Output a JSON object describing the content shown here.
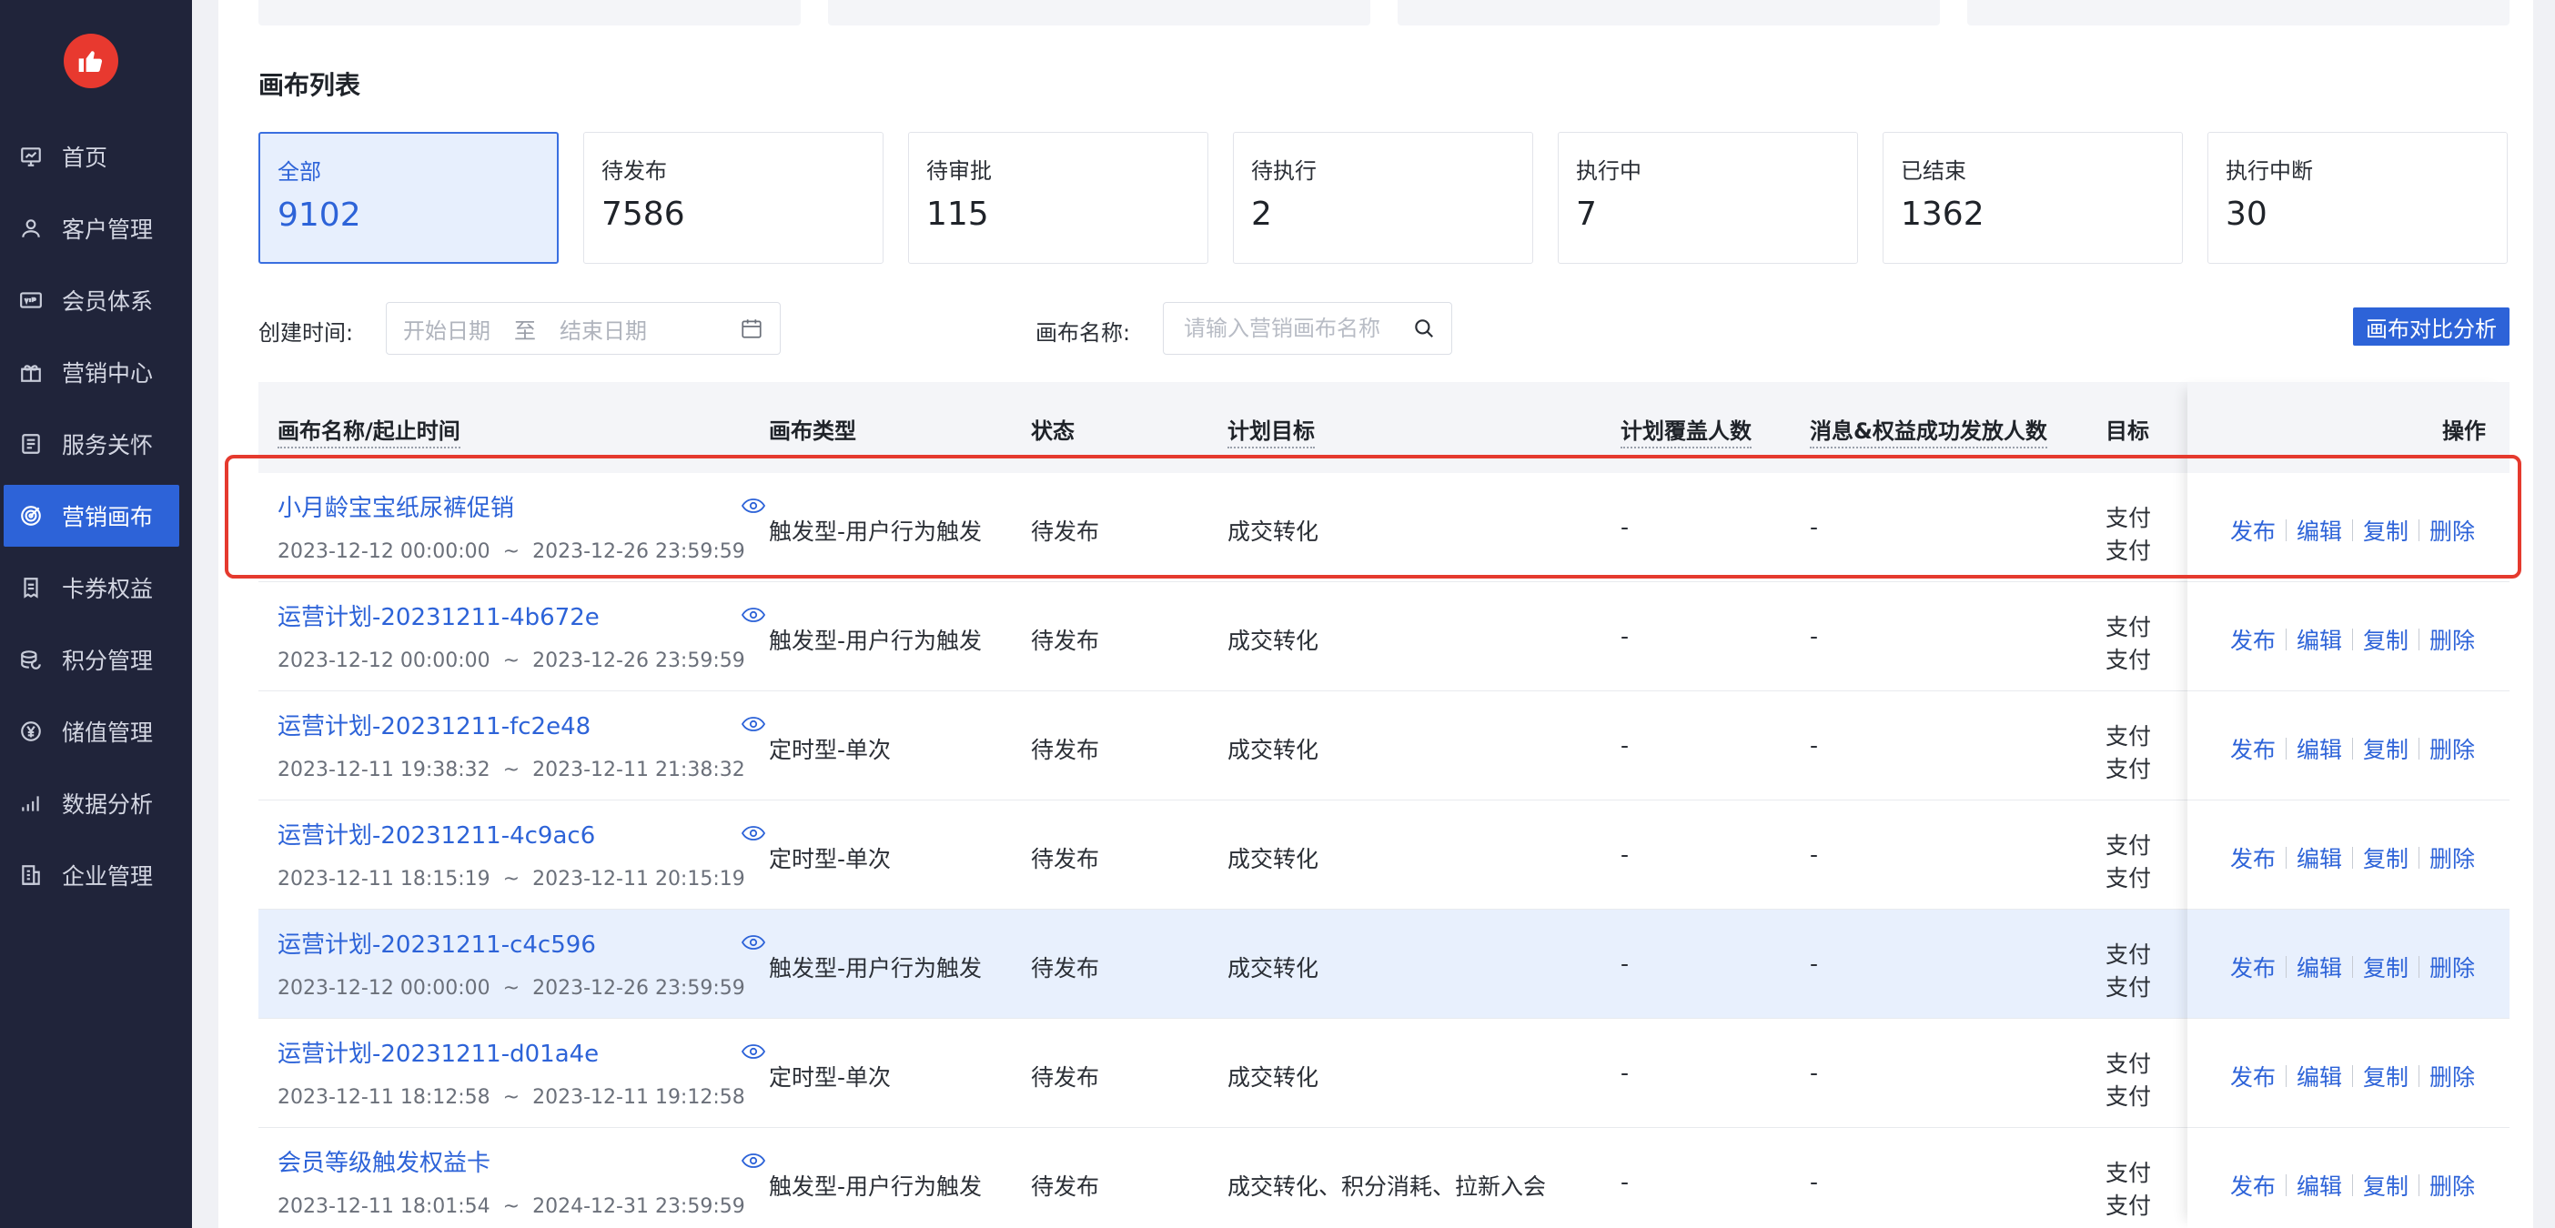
{
  "sidebar": {
    "logo_icon": "thumbs-up-icon",
    "items": [
      {
        "label": "首页",
        "icon": "home-board-icon"
      },
      {
        "label": "客户管理",
        "icon": "user-icon"
      },
      {
        "label": "会员体系",
        "icon": "vip-card-icon"
      },
      {
        "label": "营销中心",
        "icon": "gift-icon"
      },
      {
        "label": "服务关怀",
        "icon": "service-icon"
      },
      {
        "label": "营销画布",
        "icon": "target-icon",
        "active": true
      },
      {
        "label": "卡券权益",
        "icon": "coupon-icon"
      },
      {
        "label": "积分管理",
        "icon": "coins-icon"
      },
      {
        "label": "储值管理",
        "icon": "yuan-icon"
      },
      {
        "label": "数据分析",
        "icon": "bar-chart-icon"
      },
      {
        "label": "企业管理",
        "icon": "building-icon"
      }
    ]
  },
  "section_title": "画布列表",
  "stats": [
    {
      "label": "全部",
      "value": "9102",
      "active": true
    },
    {
      "label": "待发布",
      "value": "7586"
    },
    {
      "label": "待审批",
      "value": "115"
    },
    {
      "label": "待执行",
      "value": "2"
    },
    {
      "label": "执行中",
      "value": "7"
    },
    {
      "label": "已结束",
      "value": "1362"
    },
    {
      "label": "执行中断",
      "value": "30"
    }
  ],
  "filters": {
    "created_label": "创建时间:",
    "start_placeholder": "开始日期",
    "range_sep": "至",
    "end_placeholder": "结束日期",
    "name_label": "画布名称:",
    "name_placeholder": "请输入营销画布名称",
    "compare_button": "画布对比分析"
  },
  "table": {
    "headers": {
      "name": "画布名称/起止时间",
      "type": "画布类型",
      "status": "状态",
      "goal": "计划目标",
      "coverage": "计划覆盖人数",
      "sent": "消息&权益成功发放人数",
      "target": "目标",
      "ops": "操作"
    },
    "ops": {
      "publish": "发布",
      "edit": "编辑",
      "copy": "复制",
      "delete": "删除"
    },
    "target_line1": "支付",
    "target_line2": "支付",
    "rows": [
      {
        "name": "小月龄宝宝纸尿裤促销",
        "start": "2023-12-12  00:00:00",
        "sep": "~",
        "end": "2023-12-26  23:59:59",
        "type": "触发型-用户行为触发",
        "status": "待发布",
        "goal": "成交转化",
        "coverage": "-",
        "sent": "-"
      },
      {
        "name": "运营计划-20231211-4b672e",
        "start": "2023-12-12  00:00:00",
        "sep": "~",
        "end": "2023-12-26  23:59:59",
        "type": "触发型-用户行为触发",
        "status": "待发布",
        "goal": "成交转化",
        "coverage": "-",
        "sent": "-"
      },
      {
        "name": "运营计划-20231211-fc2e48",
        "start": "2023-12-11  19:38:32",
        "sep": "~",
        "end": "2023-12-11  21:38:32",
        "type": "定时型-单次",
        "status": "待发布",
        "goal": "成交转化",
        "coverage": "-",
        "sent": "-"
      },
      {
        "name": "运营计划-20231211-4c9ac6",
        "start": "2023-12-11  18:15:19",
        "sep": "~",
        "end": "2023-12-11  20:15:19",
        "type": "定时型-单次",
        "status": "待发布",
        "goal": "成交转化",
        "coverage": "-",
        "sent": "-"
      },
      {
        "name": "运营计划-20231211-c4c596",
        "start": "2023-12-12  00:00:00",
        "sep": "~",
        "end": "2023-12-26  23:59:59",
        "type": "触发型-用户行为触发",
        "status": "待发布",
        "goal": "成交转化",
        "coverage": "-",
        "sent": "-",
        "highlight": true
      },
      {
        "name": "运营计划-20231211-d01a4e",
        "start": "2023-12-11  18:12:58",
        "sep": "~",
        "end": "2023-12-11  19:12:58",
        "type": "定时型-单次",
        "status": "待发布",
        "goal": "成交转化",
        "coverage": "-",
        "sent": "-"
      },
      {
        "name": "会员等级触发权益卡",
        "start": "2023-12-11  18:01:54",
        "sep": "~",
        "end": "2024-12-31  23:59:59",
        "type": "触发型-用户行为触发",
        "status": "待发布",
        "goal": "成交转化、积分消耗、拉新入会",
        "coverage": "-",
        "sent": "-"
      }
    ]
  },
  "colors": {
    "accent": "#2d63d8",
    "sidebar": "#20243a",
    "highlight_frame": "#e53a2e"
  }
}
